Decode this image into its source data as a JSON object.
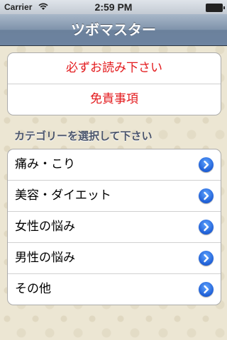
{
  "status_bar": {
    "carrier": "Carrier",
    "time": "2:59 PM"
  },
  "nav": {
    "title": "ツボマスター"
  },
  "info_group": {
    "items": [
      {
        "label": "必ずお読み下さい"
      },
      {
        "label": "免責事項"
      }
    ]
  },
  "categories": {
    "header": "カテゴリーを選択して下さい",
    "items": [
      {
        "label": "痛み・こり"
      },
      {
        "label": "美容・ダイエット"
      },
      {
        "label": "女性の悩み"
      },
      {
        "label": "男性の悩み"
      },
      {
        "label": "その他"
      }
    ]
  },
  "colors": {
    "accent_red": "#e3191c",
    "nav_blue": "#6d83a0",
    "disclosure_blue": "#1f5fd6"
  }
}
